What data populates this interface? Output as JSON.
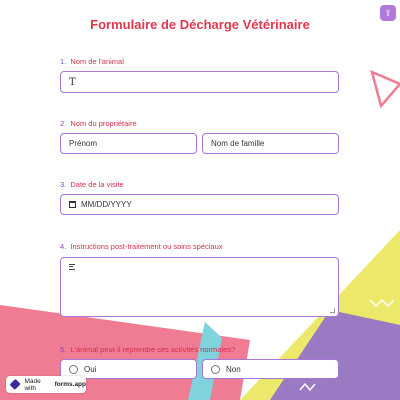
{
  "form": {
    "title": "Formulaire de Décharge Vétérinaire"
  },
  "questions": [
    {
      "number": "1.",
      "label": "Nom de l'animal"
    },
    {
      "number": "2.",
      "label": "Nom du propriétaire"
    },
    {
      "number": "3.",
      "label": "Date de la visite"
    },
    {
      "number": "4.",
      "label": "Instructions post-traitement ou soins spéciaux"
    },
    {
      "number": "5.",
      "label": "L'animal peut-il reprendre ses activités normales?"
    }
  ],
  "fields": {
    "first_name_placeholder": "Prénom",
    "last_name_placeholder": "Nom de famille",
    "date_placeholder": "MM/DD/YYYY"
  },
  "options": [
    "Oui",
    "Non"
  ],
  "footer": {
    "made_with": "Made with",
    "brand": "forms.app"
  },
  "icons": {
    "share": "share-icon",
    "text_field": "text-cursor-icon",
    "date": "calendar-icon",
    "paragraph": "paragraph-lines-icon",
    "logo": "forms-app-logo-icon"
  },
  "colors": {
    "title": "#e0394f",
    "question_label": "#d4304a",
    "question_number": "#8a3fc8",
    "field_border": "#a877d6",
    "bg_pink": "#f07c93",
    "bg_yellow": "#ece86a",
    "bg_purple": "#9a7ac2",
    "bg_cyan": "#7fd3dc"
  }
}
